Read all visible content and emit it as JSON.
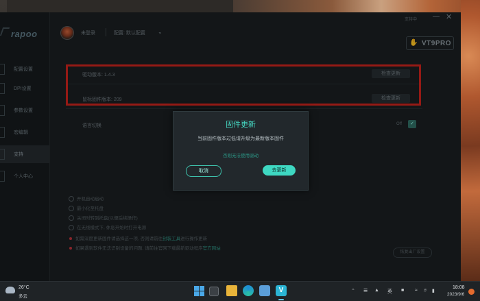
{
  "app": {
    "logo": "rapoo",
    "top_hint": "支持中",
    "user_name": "未登录",
    "config_label": "配置: 默认配置",
    "device_name": "VT9PRO"
  },
  "sidebar": {
    "items": [
      {
        "label": "配置设置"
      },
      {
        "label": "DPI设置"
      },
      {
        "label": "参数设置"
      },
      {
        "label": "宏编辑"
      },
      {
        "label": "支持"
      },
      {
        "label": "个人中心"
      }
    ]
  },
  "content": {
    "driver_version": "驱动版本: 1.4.3",
    "driver_check": "检查更新",
    "firmware_version": "鼠标固件版本: 209",
    "firmware_check": "检查更新",
    "language": "语言切换",
    "toggle_text": "Off",
    "options": [
      "开机自动启动",
      "最小化至托盘",
      "关闭时转到托盘(以便后续操作)",
      "在无线模式下, 休息开始时打开电源"
    ],
    "notes": [
      {
        "prefix": "如需深度更新固件请选择这一项, 否则请前往",
        "link": "封装工具",
        "suffix": "进行操作更新"
      },
      {
        "prefix": "如果遇到软件无法识别设备的问题, 请前往官网下载最新驱动程序",
        "link": "官方网站",
        "suffix": ""
      }
    ],
    "restore_button": "恢复出厂设置"
  },
  "modal": {
    "title": "固件更新",
    "message": "当前固件版本过低请升级为最新版本固件",
    "link": "否则无法使用驱动",
    "cancel": "取消",
    "update": "去更新"
  },
  "taskbar": {
    "weather_temp": "26°C",
    "weather_desc": "多云",
    "tray_ime": "英",
    "time": "18:08",
    "date": "2023/9/6"
  }
}
